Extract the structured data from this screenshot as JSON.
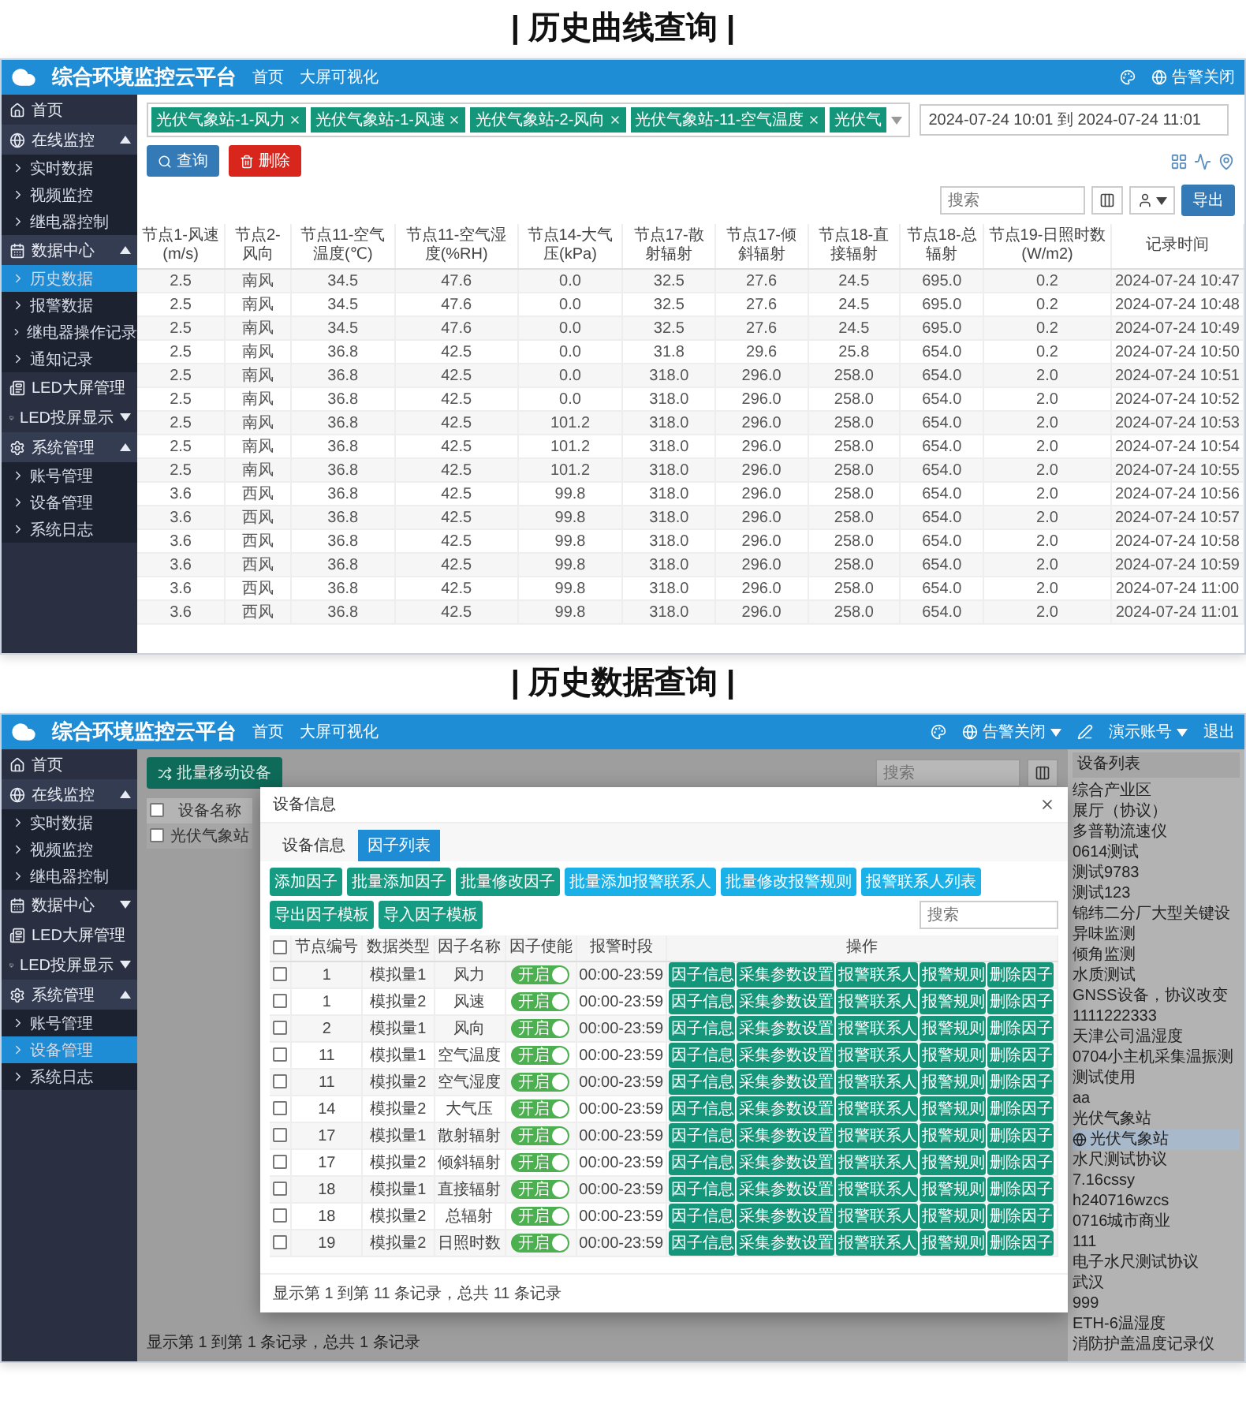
{
  "curve_section": {
    "heading": "| 历史曲线查询 |",
    "header": {
      "title": "综合环境监控云平台",
      "nav": [
        "首页",
        "大屏可视化"
      ],
      "right": [
        {
          "label": "告警关闭",
          "kind": "alarm",
          "dropdown": false
        }
      ]
    },
    "sidebar": {
      "items": [
        {
          "label": "首页",
          "kind": "link",
          "selected": false
        },
        {
          "label": "在线监控",
          "kind": "group",
          "expanded": true,
          "selected": false,
          "children": [
            {
              "label": "实时数据",
              "selected": false
            },
            {
              "label": "视频监控",
              "selected": false
            },
            {
              "label": "继电器控制",
              "selected": false
            }
          ]
        },
        {
          "label": "数据中心",
          "kind": "group",
          "expanded": true,
          "selected": false,
          "children": [
            {
              "label": "历史数据",
              "selected": true
            },
            {
              "label": "报警数据",
              "selected": false
            },
            {
              "label": "继电器操作记录",
              "selected": false
            },
            {
              "label": "通知记录",
              "selected": false
            }
          ]
        },
        {
          "label": "LED大屏管理",
          "kind": "link",
          "selected": false
        },
        {
          "label": "LED投屏显示",
          "kind": "group",
          "expanded": false,
          "selected": false
        },
        {
          "label": "系统管理",
          "kind": "group",
          "expanded": true,
          "selected": false,
          "children": [
            {
              "label": "账号管理",
              "selected": false
            },
            {
              "label": "设备管理",
              "selected": false
            },
            {
              "label": "系统日志",
              "selected": false
            }
          ]
        }
      ]
    },
    "filter": {
      "tags": [
        {
          "label": "光伏气象站-1-风力",
          "closable": true
        },
        {
          "label": "光伏气象站-1-风速",
          "closable": true
        },
        {
          "label": "光伏气象站-2-风向",
          "closable": true
        },
        {
          "label": "光伏气象站-11-空气温度",
          "closable": true
        },
        {
          "label": "光伏气",
          "closable": false
        }
      ],
      "date_range": "2024-07-24 10:01 到 2024-07-24 11:01",
      "buttons": [
        {
          "label": "查询",
          "kind": "query"
        },
        {
          "label": "删除",
          "kind": "delete"
        }
      ]
    },
    "toolbar": {
      "search": {
        "placeholder": "搜索"
      },
      "export": "导出"
    },
    "table": {
      "columns": [
        "节点1-风速(m/s)",
        "节点2-风向",
        "节点11-空气温度(℃)",
        "节点11-空气湿度(%RH)",
        "节点14-大气压(kPa)",
        "节点17-散射辐射",
        "节点17-倾斜辐射",
        "节点18-直接辐射",
        "节点18-总辐射",
        "节点19-日照时数(W/m2)",
        "记录时间"
      ],
      "rows": [
        [
          "2.5",
          "南风",
          "34.5",
          "47.6",
          "0.0",
          "32.5",
          "27.6",
          "24.5",
          "695.0",
          "0.2",
          "2024-07-24 10:47"
        ],
        [
          "2.5",
          "南风",
          "34.5",
          "47.6",
          "0.0",
          "32.5",
          "27.6",
          "24.5",
          "695.0",
          "0.2",
          "2024-07-24 10:48"
        ],
        [
          "2.5",
          "南风",
          "34.5",
          "47.6",
          "0.0",
          "32.5",
          "27.6",
          "24.5",
          "695.0",
          "0.2",
          "2024-07-24 10:49"
        ],
        [
          "2.5",
          "南风",
          "36.8",
          "42.5",
          "0.0",
          "31.8",
          "29.6",
          "25.8",
          "654.0",
          "0.2",
          "2024-07-24 10:50"
        ],
        [
          "2.5",
          "南风",
          "36.8",
          "42.5",
          "0.0",
          "318.0",
          "296.0",
          "258.0",
          "654.0",
          "2.0",
          "2024-07-24 10:51"
        ],
        [
          "2.5",
          "南风",
          "36.8",
          "42.5",
          "0.0",
          "318.0",
          "296.0",
          "258.0",
          "654.0",
          "2.0",
          "2024-07-24 10:52"
        ],
        [
          "2.5",
          "南风",
          "36.8",
          "42.5",
          "101.2",
          "318.0",
          "296.0",
          "258.0",
          "654.0",
          "2.0",
          "2024-07-24 10:53"
        ],
        [
          "2.5",
          "南风",
          "36.8",
          "42.5",
          "101.2",
          "318.0",
          "296.0",
          "258.0",
          "654.0",
          "2.0",
          "2024-07-24 10:54"
        ],
        [
          "2.5",
          "南风",
          "36.8",
          "42.5",
          "101.2",
          "318.0",
          "296.0",
          "258.0",
          "654.0",
          "2.0",
          "2024-07-24 10:55"
        ],
        [
          "3.6",
          "西风",
          "36.8",
          "42.5",
          "99.8",
          "318.0",
          "296.0",
          "258.0",
          "654.0",
          "2.0",
          "2024-07-24 10:56"
        ],
        [
          "3.6",
          "西风",
          "36.8",
          "42.5",
          "99.8",
          "318.0",
          "296.0",
          "258.0",
          "654.0",
          "2.0",
          "2024-07-24 10:57"
        ],
        [
          "3.6",
          "西风",
          "36.8",
          "42.5",
          "99.8",
          "318.0",
          "296.0",
          "258.0",
          "654.0",
          "2.0",
          "2024-07-24 10:58"
        ],
        [
          "3.6",
          "西风",
          "36.8",
          "42.5",
          "99.8",
          "318.0",
          "296.0",
          "258.0",
          "654.0",
          "2.0",
          "2024-07-24 10:59"
        ],
        [
          "3.6",
          "西风",
          "36.8",
          "42.5",
          "99.8",
          "318.0",
          "296.0",
          "258.0",
          "654.0",
          "2.0",
          "2024-07-24 11:00"
        ],
        [
          "3.6",
          "西风",
          "36.8",
          "42.5",
          "99.8",
          "318.0",
          "296.0",
          "258.0",
          "654.0",
          "2.0",
          "2024-07-24 11:01"
        ]
      ]
    }
  },
  "data_section": {
    "heading": "| 历史数据查询 |",
    "header": {
      "title": "综合环境监控云平台",
      "nav": [
        "首页",
        "大屏可视化"
      ],
      "right": [
        {
          "label": "告警关闭",
          "kind": "alarm",
          "dropdown": true
        },
        {
          "label": "演示账号",
          "kind": "account",
          "dropdown": true
        },
        {
          "label": "退出",
          "kind": "logout",
          "dropdown": false
        }
      ]
    },
    "sidebar": {
      "items": [
        {
          "label": "首页",
          "kind": "link",
          "selected": false
        },
        {
          "label": "在线监控",
          "kind": "group",
          "expanded": true,
          "selected": false,
          "children": [
            {
              "label": "实时数据",
              "selected": false
            },
            {
              "label": "视频监控",
              "selected": false
            },
            {
              "label": "继电器控制",
              "selected": false
            }
          ]
        },
        {
          "label": "数据中心",
          "kind": "group",
          "expanded": false,
          "selected": false
        },
        {
          "label": "LED大屏管理",
          "kind": "link",
          "selected": false
        },
        {
          "label": "LED投屏显示",
          "kind": "group",
          "expanded": false,
          "selected": false
        },
        {
          "label": "系统管理",
          "kind": "group",
          "expanded": true,
          "selected": false,
          "children": [
            {
              "label": "账号管理",
              "selected": false
            },
            {
              "label": "设备管理",
              "selected": true
            },
            {
              "label": "系统日志",
              "selected": false
            }
          ]
        }
      ]
    },
    "background": {
      "move_button": "批量移动设备",
      "search": {
        "placeholder": "搜索"
      },
      "table": {
        "columns": [
          "设备名称"
        ],
        "header_checked": false,
        "rows": [
          {
            "cells": [
              "光伏气象站"
            ],
            "checked": false
          }
        ]
      },
      "footer": "显示第 1 到第 1 条记录，总共 1 条记录"
    },
    "device_panel": {
      "title": "设备列表",
      "items": [
        {
          "label": "综合产业区",
          "selected": false
        },
        {
          "label": "展厅（协议）",
          "selected": false
        },
        {
          "label": "多普勒流速仪",
          "selected": false
        },
        {
          "label": "0614测试",
          "selected": false
        },
        {
          "label": "测试9783",
          "selected": false
        },
        {
          "label": "测试123",
          "selected": false
        },
        {
          "label": "锦纬二分厂大型关键设",
          "selected": false
        },
        {
          "label": "异味监测",
          "selected": false
        },
        {
          "label": "倾角监测",
          "selected": false
        },
        {
          "label": "水质测试",
          "selected": false
        },
        {
          "label": "GNSS设备，协议改变",
          "selected": false
        },
        {
          "label": "1111222333",
          "selected": false
        },
        {
          "label": "天津公司温湿度",
          "selected": false
        },
        {
          "label": "0704小主机采集温振测",
          "selected": false
        },
        {
          "label": "测试使用",
          "selected": false
        },
        {
          "label": "aa",
          "selected": false
        },
        {
          "label": "光伏气象站",
          "selected": false
        },
        {
          "label": "光伏气象站",
          "selected": true
        },
        {
          "label": "水尺测试协议",
          "selected": false
        },
        {
          "label": "7.16cssy",
          "selected": false
        },
        {
          "label": "h240716wzcs",
          "selected": false
        },
        {
          "label": "0716城市商业",
          "selected": false
        },
        {
          "label": "111",
          "selected": false
        },
        {
          "label": "电子水尺测试协议",
          "selected": false
        },
        {
          "label": "武汉",
          "selected": false
        },
        {
          "label": "999",
          "selected": false
        },
        {
          "label": "ETH-6温湿度",
          "selected": false
        },
        {
          "label": "消防护盖温度记录仪",
          "selected": false
        }
      ]
    },
    "modal": {
      "title": "设备信息",
      "tabs": [
        {
          "label": "设备信息",
          "selected": false
        },
        {
          "label": "因子列表",
          "selected": true
        }
      ],
      "buttons": [
        {
          "label": "添加因子",
          "kind": "green"
        },
        {
          "label": "批量添加因子",
          "kind": "green"
        },
        {
          "label": "批量修改因子",
          "kind": "green"
        },
        {
          "label": "批量添加报警联系人",
          "kind": "blue"
        },
        {
          "label": "批量修改报警规则",
          "kind": "blue"
        },
        {
          "label": "报警联系人列表",
          "kind": "blue"
        },
        {
          "label": "导出因子模板",
          "kind": "green"
        },
        {
          "label": "导入因子模板",
          "kind": "green"
        }
      ],
      "search": {
        "placeholder": "搜索"
      },
      "columns": [
        "节点编号",
        "数据类型",
        "因子名称",
        "因子使能",
        "报警时段",
        "操作"
      ],
      "header_checked": false,
      "rows": [
        {
          "checked": false,
          "node": "1",
          "type": "模拟量1",
          "name": "风力",
          "enabled": true,
          "toggle": "开启",
          "period": "00:00-23:59",
          "actions": [
            "因子信息",
            "采集参数设置",
            "报警联系人",
            "报警规则",
            "删除因子"
          ]
        },
        {
          "checked": false,
          "node": "1",
          "type": "模拟量2",
          "name": "风速",
          "enabled": true,
          "toggle": "开启",
          "period": "00:00-23:59",
          "actions": [
            "因子信息",
            "采集参数设置",
            "报警联系人",
            "报警规则",
            "删除因子"
          ]
        },
        {
          "checked": false,
          "node": "2",
          "type": "模拟量1",
          "name": "风向",
          "enabled": true,
          "toggle": "开启",
          "period": "00:00-23:59",
          "actions": [
            "因子信息",
            "采集参数设置",
            "报警联系人",
            "报警规则",
            "删除因子"
          ]
        },
        {
          "checked": false,
          "node": "11",
          "type": "模拟量1",
          "name": "空气温度",
          "enabled": true,
          "toggle": "开启",
          "period": "00:00-23:59",
          "actions": [
            "因子信息",
            "采集参数设置",
            "报警联系人",
            "报警规则",
            "删除因子"
          ]
        },
        {
          "checked": false,
          "node": "11",
          "type": "模拟量2",
          "name": "空气湿度",
          "enabled": true,
          "toggle": "开启",
          "period": "00:00-23:59",
          "actions": [
            "因子信息",
            "采集参数设置",
            "报警联系人",
            "报警规则",
            "删除因子"
          ]
        },
        {
          "checked": false,
          "node": "14",
          "type": "模拟量2",
          "name": "大气压",
          "enabled": true,
          "toggle": "开启",
          "period": "00:00-23:59",
          "actions": [
            "因子信息",
            "采集参数设置",
            "报警联系人",
            "报警规则",
            "删除因子"
          ]
        },
        {
          "checked": false,
          "node": "17",
          "type": "模拟量1",
          "name": "散射辐射",
          "enabled": true,
          "toggle": "开启",
          "period": "00:00-23:59",
          "actions": [
            "因子信息",
            "采集参数设置",
            "报警联系人",
            "报警规则",
            "删除因子"
          ]
        },
        {
          "checked": false,
          "node": "17",
          "type": "模拟量2",
          "name": "倾斜辐射",
          "enabled": true,
          "toggle": "开启",
          "period": "00:00-23:59",
          "actions": [
            "因子信息",
            "采集参数设置",
            "报警联系人",
            "报警规则",
            "删除因子"
          ]
        },
        {
          "checked": false,
          "node": "18",
          "type": "模拟量1",
          "name": "直接辐射",
          "enabled": true,
          "toggle": "开启",
          "period": "00:00-23:59",
          "actions": [
            "因子信息",
            "采集参数设置",
            "报警联系人",
            "报警规则",
            "删除因子"
          ]
        },
        {
          "checked": false,
          "node": "18",
          "type": "模拟量2",
          "name": "总辐射",
          "enabled": true,
          "toggle": "开启",
          "period": "00:00-23:59",
          "actions": [
            "因子信息",
            "采集参数设置",
            "报警联系人",
            "报警规则",
            "删除因子"
          ]
        },
        {
          "checked": false,
          "node": "19",
          "type": "模拟量2",
          "name": "日照时数",
          "enabled": true,
          "toggle": "开启",
          "period": "00:00-23:59",
          "actions": [
            "因子信息",
            "采集参数设置",
            "报警联系人",
            "报警规则",
            "删除因子"
          ]
        }
      ],
      "footer": "显示第 1 到第 11 条记录，总共 11 条记录"
    }
  }
}
